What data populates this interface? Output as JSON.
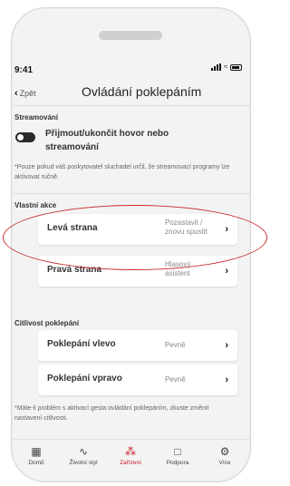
{
  "status_bar": {
    "time": "9:41"
  },
  "nav": {
    "back_label": "Zpět",
    "title": "Ovládání poklepáním"
  },
  "streaming": {
    "section_label": "Streamování",
    "toggle_label": "Přijmout/ukončit hovor nebo streamování",
    "toggle_state": "off",
    "note": "*Pouze pokud váš poskytovatel sluchadel určil, že streamovací programy lze aktivovat ručně."
  },
  "custom_actions": {
    "section_label": "Vlastní akce",
    "items": [
      {
        "label": "Levá strana",
        "value": "Pozastavit / znovu spustit"
      },
      {
        "label": "Pravá strana",
        "value": "Hlasový asistent"
      }
    ]
  },
  "sensitivity": {
    "section_label": "Citlivost poklepání",
    "items": [
      {
        "label": "Poklepání vlevo",
        "value": "Pevně"
      },
      {
        "label": "Poklepání vpravo",
        "value": "Pevně"
      }
    ],
    "note": "*Máte-li problém s aktivací gesta ovládání poklepáním, zkuste změnit nastavení citlivosti."
  },
  "tabbar": {
    "items": [
      {
        "label": "Domů",
        "icon": "grid-icon"
      },
      {
        "label": "Životní styl",
        "icon": "pulse-icon"
      },
      {
        "label": "Zařízení",
        "icon": "hearing-aid-icon"
      },
      {
        "label": "Podpora",
        "icon": "chat-icon"
      },
      {
        "label": "Více",
        "icon": "gear-icon"
      }
    ],
    "active_index": 2
  },
  "colors": {
    "accent": "#d11a2a",
    "annotation": "#c92a2a",
    "background": "#f3f3f3"
  }
}
